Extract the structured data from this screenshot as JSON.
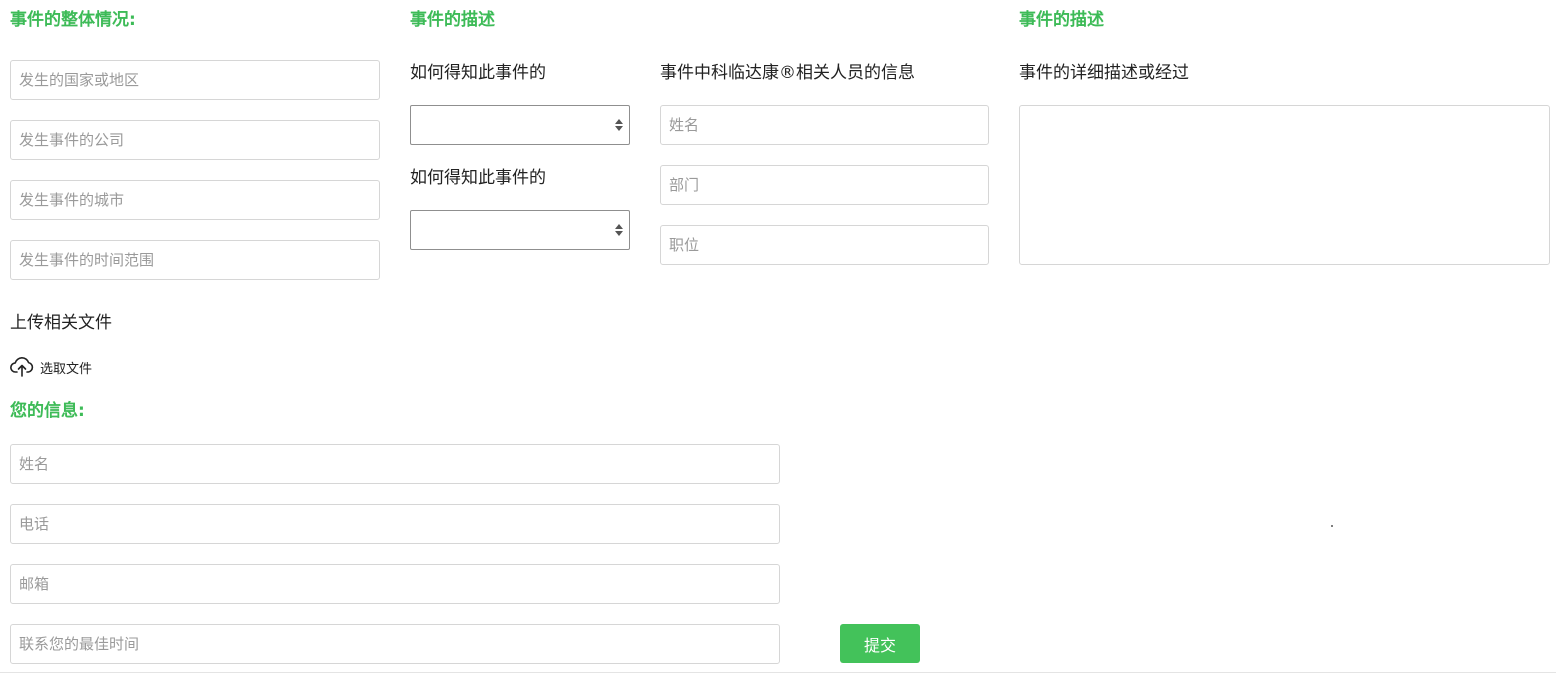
{
  "overall": {
    "title": "事件的整体情况:",
    "country_placeholder": "发生的国家或地区",
    "company_placeholder": "发生事件的公司",
    "city_placeholder": "发生事件的城市",
    "time_range_placeholder": "发生事件的时间范围"
  },
  "description": {
    "title": "事件的描述",
    "how_known_label_1": "如何得知此事件的",
    "how_known_label_2": "如何得知此事件的"
  },
  "staff": {
    "label": "事件中科临达康®相关人员的信息",
    "name_placeholder": "姓名",
    "department_placeholder": "部门",
    "position_placeholder": "职位"
  },
  "detail": {
    "title": "事件的描述",
    "label": "事件的详细描述或经过"
  },
  "upload": {
    "label": "上传相关文件",
    "button_label": "选取文件",
    "icon": "cloud-upload-icon"
  },
  "your_info": {
    "title": "您的信息:",
    "name_placeholder": "姓名",
    "phone_placeholder": "电话",
    "email_placeholder": "邮箱",
    "best_time_placeholder": "联系您的最佳时间"
  },
  "submit_label": "提交",
  "colors": {
    "accent": "#3dbb57",
    "button": "#43c25a",
    "border": "#d6d6d6"
  }
}
